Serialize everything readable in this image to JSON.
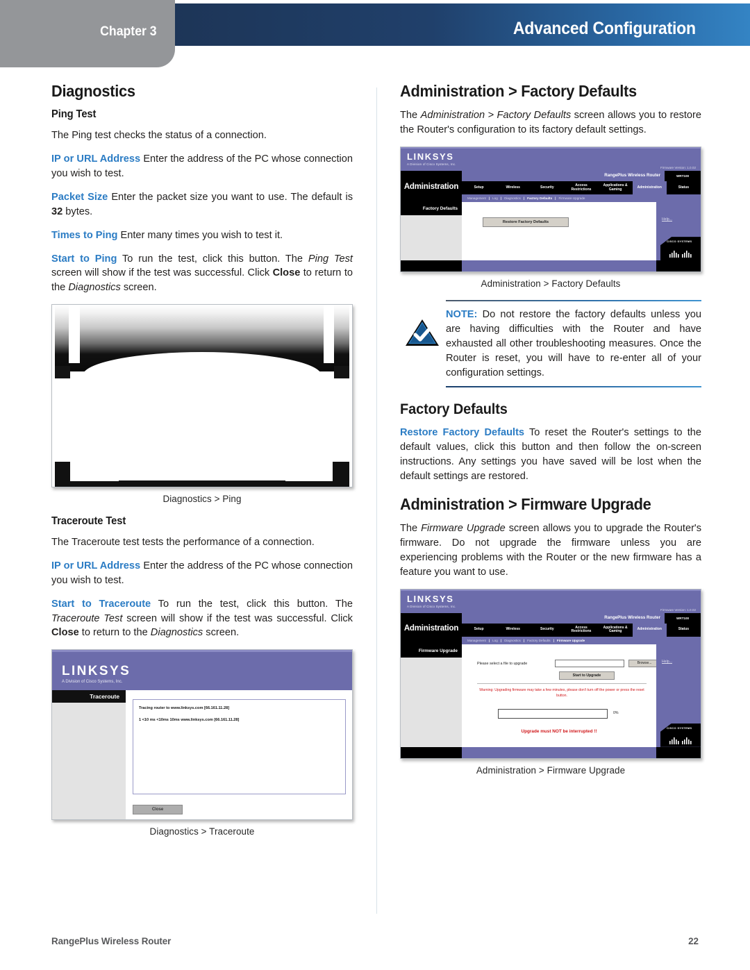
{
  "header": {
    "chapter_label": "Chapter 3",
    "title": "Advanced Configuration",
    "gray": "#949699",
    "navy": "#1d3557",
    "blue": "#3484c4"
  },
  "accent_color": "#2b7cc4",
  "left_column": {
    "heading": "Diagnostics",
    "ping": {
      "subheading": "Ping Test",
      "intro": "The Ping test checks the status of a connection.",
      "items": [
        {
          "term": "IP or URL Address",
          "text": "Enter the address of the PC whose connection you wish to test."
        },
        {
          "term": "Packet Size",
          "text_a": "Enter the packet size you want to use. The default is ",
          "bold": "32",
          "text_b": " bytes."
        },
        {
          "term": "Times to Ping",
          "text": "Enter many times you wish to test it."
        },
        {
          "term": "Start to Ping",
          "text_a": "To run the test, click this button. The ",
          "italic_a": "Ping Test",
          "text_b": " screen will show if the test was successful. Click ",
          "bold": "Close",
          "text_c": " to return to the ",
          "italic_b": "Diagnostics",
          "text_d": " screen."
        }
      ],
      "figure_caption": "Diagnostics > Ping"
    },
    "traceroute": {
      "subheading": "Traceroute Test",
      "intro": "The Traceroute test tests the performance of a connection.",
      "items": [
        {
          "term": "IP or URL Address",
          "text": "Enter the address of the PC whose connection you wish to test."
        },
        {
          "term": "Start to Traceroute",
          "text_a": "To run the test, click this button. The ",
          "italic_a": "Traceroute Test",
          "text_b": " screen will show if the test was successful. Click ",
          "bold": "Close",
          "text_c": " to return to the ",
          "italic_b": "Diagnostics",
          "text_d": " screen."
        }
      ],
      "figure_caption": "Diagnostics > Traceroute",
      "screenshot": {
        "brand": "LINKSYS",
        "brand_sub": "A Division of Cisco Systems, Inc.",
        "sidebar_label": "Traceroute",
        "console_line_1": "Tracing router to www.linksys.com [66.161.11.28]",
        "console_line_2": "1   <10 ms  <10ms   10ms   www.linksys.com [66.161.11.28]",
        "close_button": "Close"
      }
    }
  },
  "right_column": {
    "factory_defaults_screen": {
      "heading": "Administration > Factory Defaults",
      "intro_a": "The ",
      "intro_italic": "Administration > Factory Defaults",
      "intro_b": " screen allows you to restore the Router's configuration to its factory default settings.",
      "figure_caption": "Administration > Factory Defaults",
      "screenshot": {
        "brand": "LINKSYS",
        "brand_sub": "A Division of Cisco Systems, Inc.",
        "firmware_version": "Firmware Version: 1.0.02",
        "section": "Administration",
        "model_title": "RangePlus Wireless Router",
        "model_number": "WRT100",
        "tabs": [
          "Setup",
          "Wireless",
          "Security",
          "Access Restrictions",
          "Applications & Gaming",
          "Administration",
          "Status"
        ],
        "active_tab": "Administration",
        "subnav": [
          "Management",
          "Log",
          "Diagnostics",
          "Factory Defaults",
          "Firmware Upgrade"
        ],
        "subnav_current": "Factory Defaults",
        "sidebar_label": "Factory Defaults",
        "restore_button": "Restore Factory Defaults",
        "help_link": "Help...",
        "cisco_label": "CISCO SYSTEMS"
      }
    },
    "note": {
      "keyword": "NOTE:",
      "text": " Do not restore the factory defaults unless you are having difficulties with the Router and have exhausted all other troubleshooting measures. Once the Router is reset, you will have to re-enter all of your configuration settings."
    },
    "factory_defaults": {
      "heading": "Factory Defaults",
      "term": "Restore Factory Defaults",
      "text": "To reset the Router's settings to the default values, click this button and then follow the on-screen instructions. Any settings you have saved will be lost when the default settings are restored."
    },
    "firmware_upgrade": {
      "heading": "Administration > Firmware Upgrade",
      "intro_a": "The ",
      "intro_italic": "Firmware Upgrade",
      "intro_b": " screen allows you to upgrade the Router's firmware. Do not upgrade the firmware unless you are experiencing problems with the Router or the new firmware has a feature you want to use.",
      "figure_caption": "Administration > Firmware Upgrade",
      "screenshot": {
        "brand": "LINKSYS",
        "brand_sub": "A Division of Cisco Systems, Inc.",
        "firmware_version": "Firmware Version: 1.0.02",
        "section": "Administration",
        "model_title": "RangePlus Wireless Router",
        "model_number": "WRT100",
        "tabs": [
          "Setup",
          "Wireless",
          "Security",
          "Access Restrictions",
          "Applications & Gaming",
          "Administration",
          "Status"
        ],
        "active_tab": "Administration",
        "subnav": [
          "Management",
          "Log",
          "Diagnostics",
          "Factory Defaults",
          "Firmware Upgrade"
        ],
        "subnav_current": "Firmware Upgrade",
        "sidebar_label": "Firmware Upgrade",
        "file_label": "Please select a file to upgrade",
        "file_value": "",
        "browse_button": "Browse...",
        "start_button": "Start to Upgrade",
        "warning": "Warning: Upgrading firmware may take a few minutes, please don't turn off the power or press the reset button.",
        "progress_percent": "0%",
        "must_not_text": "Upgrade must NOT be interrupted !!",
        "help_link": "Help...",
        "cisco_label": "CISCO SYSTEMS"
      }
    }
  },
  "footer": {
    "product": "RangePlus Wireless Router",
    "page_number": "22"
  }
}
